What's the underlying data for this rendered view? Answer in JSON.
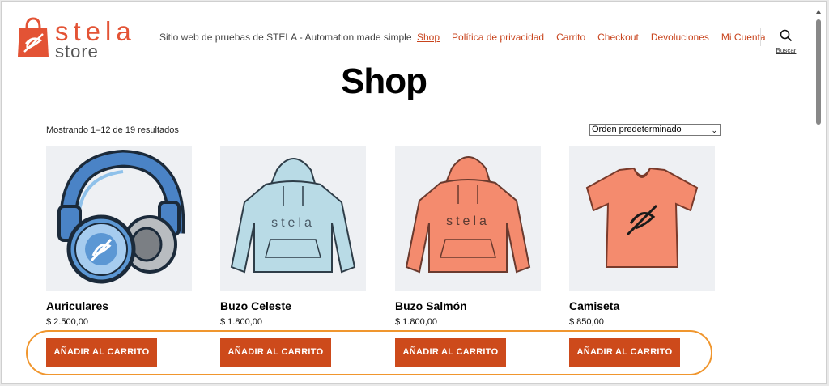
{
  "brand": {
    "word1": "stela",
    "word2": "store",
    "tagline": "Sitio web de pruebas de STELA - Automation made simple"
  },
  "nav": [
    {
      "label": "Shop",
      "active": true
    },
    {
      "label": "Política de privacidad"
    },
    {
      "label": "Carrito"
    },
    {
      "label": "Checkout"
    },
    {
      "label": "Devoluciones"
    },
    {
      "label": "Mi Cuenta"
    }
  ],
  "search": {
    "label": "Buscar",
    "icon": "search-icon"
  },
  "page": {
    "title": "Shop"
  },
  "shop": {
    "result_count": "Mostrando 1–12 de 19 resultados",
    "order_selected": "Orden predeterminado"
  },
  "products": [
    {
      "name": "Auriculares",
      "price": "$ 2.500,00",
      "button": "AÑADIR AL CARRITO",
      "image": "headphones-image"
    },
    {
      "name": "Buzo Celeste",
      "price": "$ 1.800,00",
      "button": "AÑADIR AL CARRITO",
      "image": "light-blue-hoodie-image"
    },
    {
      "name": "Buzo Salmón",
      "price": "$ 1.800,00",
      "button": "AÑADIR AL CARRITO",
      "image": "salmon-hoodie-image"
    },
    {
      "name": "Camiseta",
      "price": "$ 850,00",
      "button": "AÑADIR AL CARRITO",
      "image": "tshirt-image"
    }
  ],
  "colors": {
    "accent": "#cd4a1b",
    "nav_link": "#c8441d",
    "highlight": "#f0962e",
    "hoodie_blue": "#b9dbe6",
    "hoodie_salmon": "#f48b6e"
  }
}
